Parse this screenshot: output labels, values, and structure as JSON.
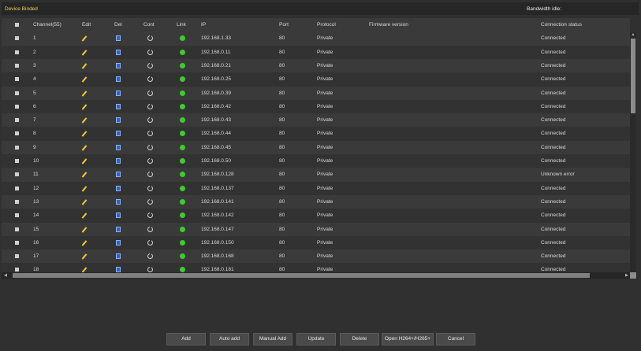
{
  "topbar": {
    "title": "Device Binded",
    "bandwidth": "Bandwidth idle:"
  },
  "table": {
    "columns": [
      "Channel(55)",
      "Edit",
      "Del",
      "Cont",
      "Link",
      "IP",
      "Port",
      "Protocol",
      "Firmware version",
      "Connection status"
    ],
    "rows": [
      {
        "ch": "1",
        "ip": "192.168.1.33",
        "port": "80",
        "protocol": "Private",
        "firmware": "",
        "status": "Connected"
      },
      {
        "ch": "2",
        "ip": "192.168.0.11",
        "port": "80",
        "protocol": "Private",
        "firmware": "",
        "status": "Connected"
      },
      {
        "ch": "3",
        "ip": "192.168.0.21",
        "port": "80",
        "protocol": "Private",
        "firmware": "",
        "status": "Connected"
      },
      {
        "ch": "4",
        "ip": "192.168.0.25",
        "port": "80",
        "protocol": "Private",
        "firmware": "",
        "status": "Connected"
      },
      {
        "ch": "5",
        "ip": "192.168.0.39",
        "port": "80",
        "protocol": "Private",
        "firmware": "",
        "status": "Connected"
      },
      {
        "ch": "6",
        "ip": "192.168.0.42",
        "port": "80",
        "protocol": "Private",
        "firmware": "",
        "status": "Connected"
      },
      {
        "ch": "7",
        "ip": "192.168.0.43",
        "port": "80",
        "protocol": "Private",
        "firmware": "",
        "status": "Connected"
      },
      {
        "ch": "8",
        "ip": "192.168.0.44",
        "port": "80",
        "protocol": "Private",
        "firmware": "",
        "status": "Connected"
      },
      {
        "ch": "9",
        "ip": "192.168.0.45",
        "port": "80",
        "protocol": "Private",
        "firmware": "",
        "status": "Connected"
      },
      {
        "ch": "10",
        "ip": "192.168.0.50",
        "port": "80",
        "protocol": "Private",
        "firmware": "",
        "status": "Connected"
      },
      {
        "ch": "11",
        "ip": "192.168.0.128",
        "port": "80",
        "protocol": "Private",
        "firmware": "",
        "status": "Unknown error"
      },
      {
        "ch": "12",
        "ip": "192.168.0.137",
        "port": "80",
        "protocol": "Private",
        "firmware": "",
        "status": "Connected"
      },
      {
        "ch": "13",
        "ip": "192.168.0.141",
        "port": "80",
        "protocol": "Private",
        "firmware": "",
        "status": "Connected"
      },
      {
        "ch": "14",
        "ip": "192.168.0.142",
        "port": "80",
        "protocol": "Private",
        "firmware": "",
        "status": "Connected"
      },
      {
        "ch": "15",
        "ip": "192.168.0.147",
        "port": "80",
        "protocol": "Private",
        "firmware": "",
        "status": "Connected"
      },
      {
        "ch": "16",
        "ip": "192.168.0.150",
        "port": "80",
        "protocol": "Private",
        "firmware": "",
        "status": "Connected"
      },
      {
        "ch": "17",
        "ip": "192.168.0.168",
        "port": "80",
        "protocol": "Private",
        "firmware": "",
        "status": "Connected"
      },
      {
        "ch": "18",
        "ip": "192.168.0.181",
        "port": "80",
        "protocol": "Private",
        "firmware": "",
        "status": "Connected"
      }
    ]
  },
  "icons": {
    "check": "checkbox-icon",
    "edit": "pencil-icon",
    "del": "trash-icon",
    "cont": "power-icon",
    "link": "green-dot-icon"
  },
  "colors": {
    "title": "#e6d25a",
    "link_ok": "#3fcb2e",
    "del_icon": "#2e63c8",
    "edit_icon": "#f0c832"
  },
  "buttons": {
    "add": "Add",
    "auto_add": "Auto add",
    "manual_add": "Manual Add",
    "update": "Update",
    "delete": "Delete",
    "open_h264": "Open H264+/H265+",
    "cancel": "Cancel"
  }
}
